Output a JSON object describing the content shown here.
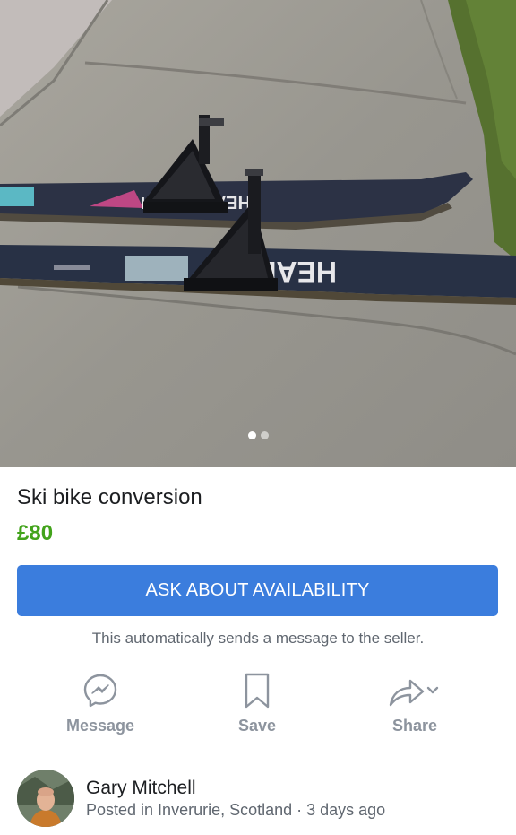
{
  "listing": {
    "title": "Ski bike conversion",
    "price": "£80",
    "photo_description": "Two HEAD skis with black ski bike conversion mounts lying on a concrete path",
    "ski_brand_text": "HEAD",
    "photo_count": 2,
    "active_photo_index": 0
  },
  "cta": {
    "label": "ASK ABOUT AVAILABILITY",
    "note": "This automatically sends a message to the seller.",
    "color": "#3b7ddd"
  },
  "actions": [
    {
      "label": "Message",
      "icon": "messenger-icon"
    },
    {
      "label": "Save",
      "icon": "bookmark-icon"
    },
    {
      "label": "Share",
      "icon": "share-arrow-icon"
    }
  ],
  "seller": {
    "name": "Gary Mitchell",
    "meta": "Posted in Inverurie, Scotland · 3 days ago"
  },
  "colors": {
    "price": "#42a31b",
    "muted_text": "#606770",
    "action_gray": "#8d949e"
  }
}
